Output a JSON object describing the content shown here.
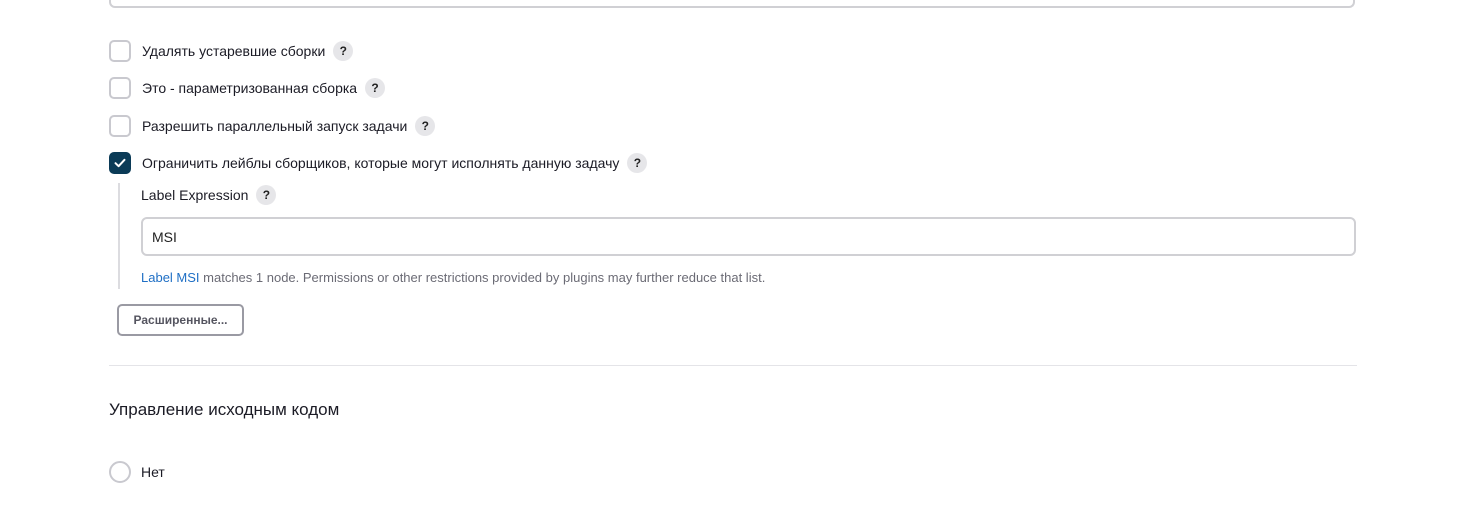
{
  "options": [
    {
      "label": "Удалять устаревшие сборки",
      "checked": false,
      "help": "?"
    },
    {
      "label": "Это - параметризованная сборка",
      "checked": false,
      "help": "?"
    },
    {
      "label": "Разрешить параллельный запуск задачи",
      "checked": false,
      "help": "?"
    },
    {
      "label": "Ограничить лейблы сборщиков, которые могут исполнять данную задачу",
      "checked": true,
      "help": "?"
    }
  ],
  "label_expression": {
    "label": "Label Expression",
    "help": "?",
    "value": "MSI",
    "hint_link": "Label MSI",
    "hint_text": " matches 1 node. Permissions or other restrictions provided by plugins may further reduce that list."
  },
  "advanced_button": "Расширенные...",
  "scm_section": {
    "title": "Управление исходным кодом",
    "radio_none_label": "Нет"
  },
  "colors": {
    "checkbox_checked": "#0b3b57",
    "link": "#1f6fc5"
  }
}
